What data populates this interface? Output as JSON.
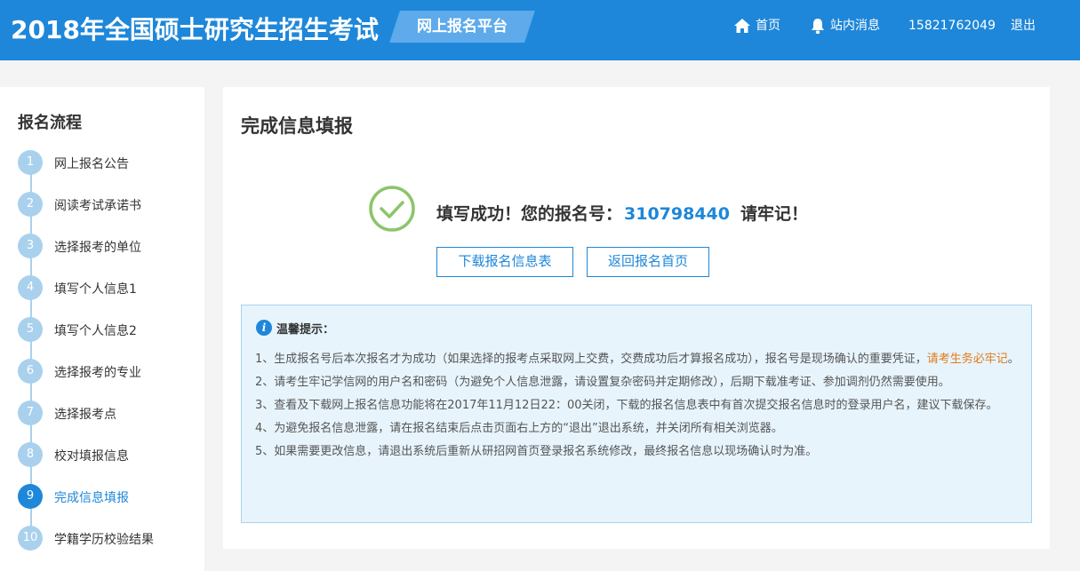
{
  "header": {
    "site_title": "2018年全国硕士研究生招生考试",
    "platform": "网上报名平台",
    "nav": {
      "home": "首页",
      "messages": "站内消息",
      "phone": "15821762049",
      "logout": "退出"
    },
    "icons": [
      "home-icon",
      "bell-icon"
    ]
  },
  "sidebar": {
    "title": "报名流程",
    "steps": [
      {
        "num": "1",
        "label": "网上报名公告"
      },
      {
        "num": "2",
        "label": "阅读考试承诺书"
      },
      {
        "num": "3",
        "label": "选择报考的单位"
      },
      {
        "num": "4",
        "label": "填写个人信息1"
      },
      {
        "num": "5",
        "label": "填写个人信息2"
      },
      {
        "num": "6",
        "label": "选择报考的专业"
      },
      {
        "num": "7",
        "label": "选择报考点"
      },
      {
        "num": "8",
        "label": "校对填报信息"
      },
      {
        "num": "9",
        "label": "完成信息填报"
      },
      {
        "num": "10",
        "label": "学籍学历校验结果"
      }
    ],
    "active_step": "9"
  },
  "main": {
    "title": "完成信息填报",
    "success_prefix": "填写成功！您的报名号：",
    "registration_number": "310798440",
    "success_suffix": "请牢记！",
    "buttons": {
      "download": "下载报名信息表",
      "back_home": "返回报名首页"
    },
    "tips": {
      "title": "温馨提示：",
      "item1_text": "1、生成报名号后本次报名才为成功（如果选择的报考点采取网上交费，交费成功后才算报名成功），报名号是现场确认的重要凭证，",
      "item1_highlight": "请考生务必牢记",
      "item1_end": "。",
      "item2": "2、请考生牢记学信网的用户名和密码（为避免个人信息泄露，请设置复杂密码并定期修改），后期下载准考证、参加调剂仍然需要使用。",
      "item3": "3、查看及下载网上报名信息功能将在2017年11月12日22：00关闭，下载的报名信息表中有首次提交报名信息时的登录用户名，建议下载保存。",
      "item4": "4、为避免报名信息泄露，请在报名结束后点击页面右上方的“退出”退出系统，并关闭所有相关浏览器。",
      "item5": "5、如果需要更改信息，请退出系统后重新从研招网首页登录报名系统修改，最终报名信息以现场确认时为准。"
    }
  },
  "colors": {
    "primary": "#1e87d9",
    "step_inactive": "#a9d1ee",
    "success_green": "#8bc56a",
    "highlight_orange": "#e07b1a",
    "tips_bg": "#e7f4fc"
  }
}
